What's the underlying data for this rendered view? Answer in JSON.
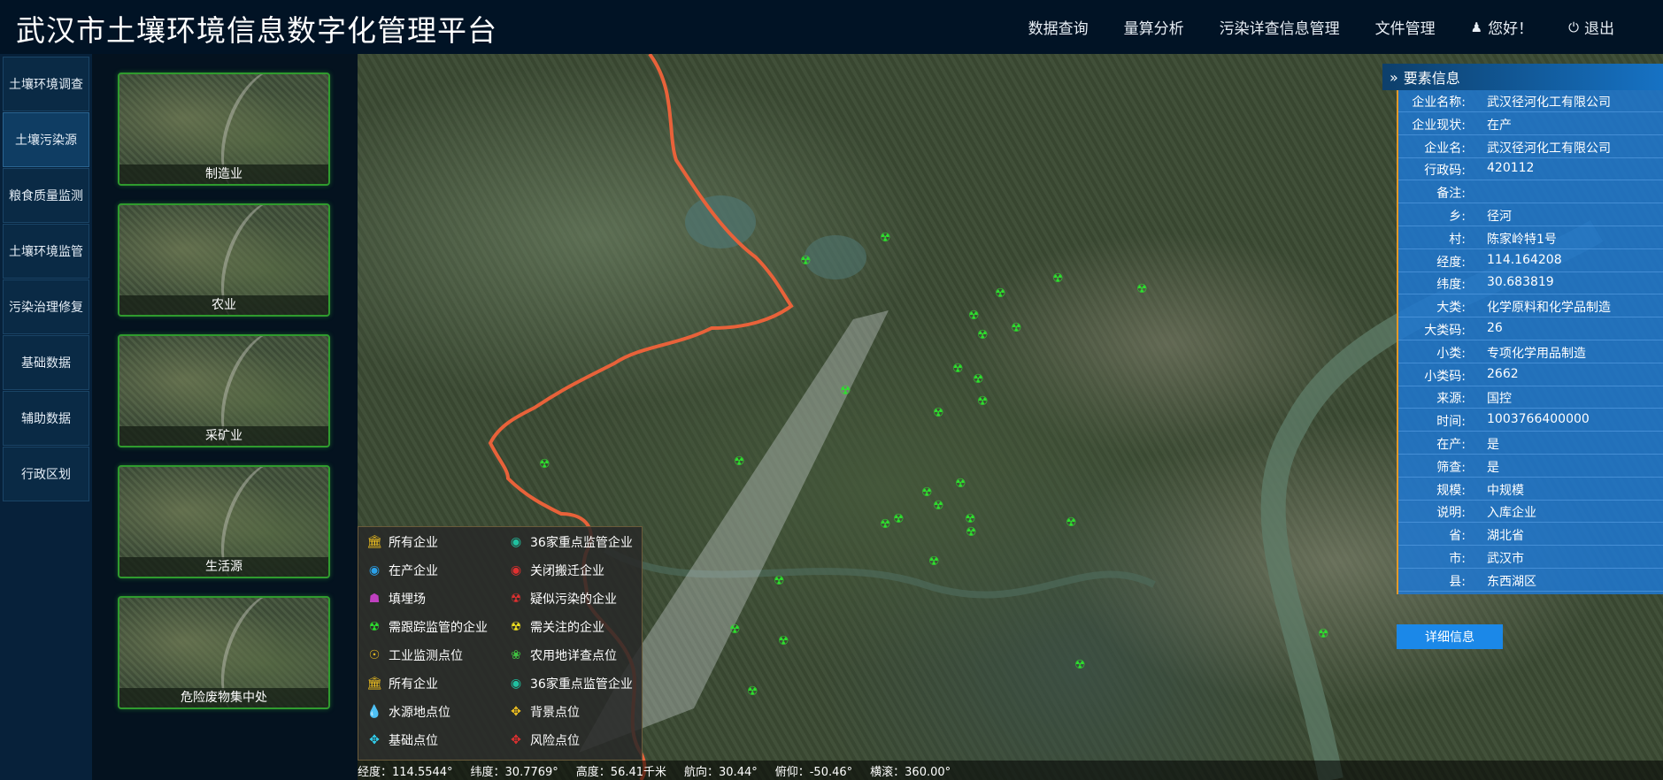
{
  "header": {
    "title": "武汉市土壤环境信息数字化管理平台",
    "nav": [
      "数据查询",
      "量算分析",
      "污染详查信息管理",
      "文件管理"
    ],
    "user_label": "您好！",
    "logout_label": "退出"
  },
  "sidebar": {
    "items": [
      "土壤环境调查",
      "土壤污染源",
      "粮食质量监测",
      "土壤环境监管",
      "污染治理修复",
      "基础数据",
      "辅助数据",
      "行政区划"
    ],
    "active": "土壤污染源"
  },
  "categories": [
    "制造业",
    "农业",
    "采矿业",
    "生活源",
    "危险废物集中处"
  ],
  "legend": {
    "left": [
      {
        "icon": "building-icon",
        "label": "所有企业",
        "color": "#f0c020"
      },
      {
        "icon": "factory-icon",
        "label": "在产企业",
        "color": "#2aa0e8"
      },
      {
        "icon": "landfill-icon",
        "label": "填埋场",
        "color": "#c040c0"
      },
      {
        "icon": "radiation-icon",
        "label": "需跟踪监管的企业",
        "color": "#2ee02e"
      },
      {
        "icon": "target-icon",
        "label": "工业监测点位",
        "color": "#f0c020"
      },
      {
        "icon": "building-icon",
        "label": "所有企业",
        "color": "#f0c020"
      },
      {
        "icon": "water-drop-icon",
        "label": "水源地点位",
        "color": "#20c0e0"
      },
      {
        "icon": "crosshair-icon",
        "label": "基础点位",
        "color": "#30d0f0"
      }
    ],
    "right": [
      {
        "icon": "factory-icon",
        "label": "36家重点监管企业",
        "color": "#20c0a0"
      },
      {
        "icon": "factory-icon",
        "label": "关闭搬迁企业",
        "color": "#e03030"
      },
      {
        "icon": "radiation-icon",
        "label": "疑似污染的企业",
        "color": "#e03030"
      },
      {
        "icon": "radiation-icon",
        "label": "需关注的企业",
        "color": "#f0e020"
      },
      {
        "icon": "leaf-icon",
        "label": "农用地详查点位",
        "color": "#40c040"
      },
      {
        "icon": "factory-icon",
        "label": "36家重点监管企业",
        "color": "#20c0a0"
      },
      {
        "icon": "crosshair-icon",
        "label": "背景点位",
        "color": "#f0c020"
      },
      {
        "icon": "crosshair-icon",
        "label": "风险点位",
        "color": "#e03030"
      }
    ]
  },
  "status": {
    "lon": "经度：114.5544°",
    "lat": "纬度：30.7769°",
    "height": "高度：56.41千米",
    "heading": "航向：30.44°",
    "pitch": "俯仰：-50.46°",
    "roll": "横滚：360.00°"
  },
  "info": {
    "title": "要素信息",
    "rows": [
      {
        "k": "企业名称:",
        "v": "武汉径河化工有限公司"
      },
      {
        "k": "企业现状:",
        "v": "在产"
      },
      {
        "k": "企业名:",
        "v": "武汉径河化工有限公司"
      },
      {
        "k": "行政码:",
        "v": "420112"
      },
      {
        "k": "备注:",
        "v": ""
      },
      {
        "k": "乡:",
        "v": "径河"
      },
      {
        "k": "村:",
        "v": "陈家岭特1号"
      },
      {
        "k": "经度:",
        "v": "114.164208"
      },
      {
        "k": "纬度:",
        "v": "30.683819"
      },
      {
        "k": "大类:",
        "v": "化学原料和化学品制造"
      },
      {
        "k": "大类码:",
        "v": "26"
      },
      {
        "k": "小类:",
        "v": "专项化学用品制造"
      },
      {
        "k": "小类码:",
        "v": "2662"
      },
      {
        "k": "来源:",
        "v": "国控"
      },
      {
        "k": "时间:",
        "v": "1003766400000"
      },
      {
        "k": "在产:",
        "v": "是"
      },
      {
        "k": "筛查:",
        "v": "是"
      },
      {
        "k": "规模:",
        "v": "中规模"
      },
      {
        "k": "说明:",
        "v": "入库企业"
      },
      {
        "k": "省:",
        "v": "湖北省"
      },
      {
        "k": "市:",
        "v": "武汉市"
      },
      {
        "k": "县:",
        "v": "东西湖区"
      }
    ],
    "detail_button": "详细信息"
  },
  "colors": {
    "boundary": "#e8623a",
    "marker": "#2ee02e",
    "panel_blue": "#1e78d2"
  }
}
